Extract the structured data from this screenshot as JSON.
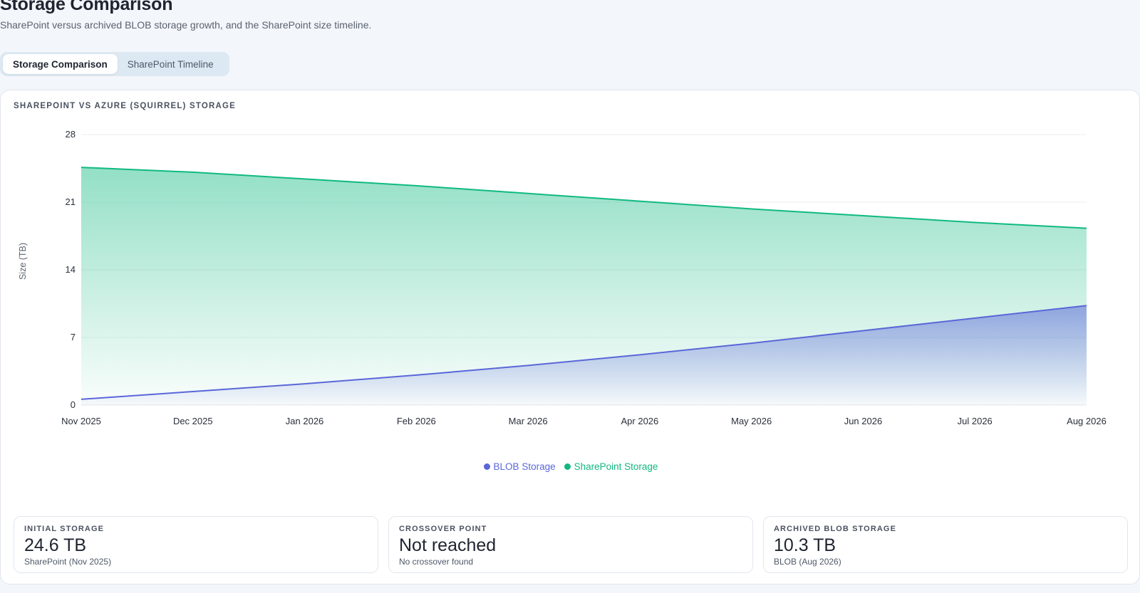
{
  "header": {
    "title": "Storage Comparison",
    "subtitle": "SharePoint versus archived BLOB storage growth, and the SharePoint size timeline."
  },
  "tabs": [
    {
      "label": "Storage Comparison",
      "active": true
    },
    {
      "label": "SharePoint Timeline",
      "active": false
    }
  ],
  "card": {
    "title": "SHAREPOINT VS AZURE (SQUIRREL) STORAGE"
  },
  "chart_data": {
    "type": "area",
    "categories": [
      "Nov 2025",
      "Dec 2025",
      "Jan 2026",
      "Feb 2026",
      "Mar 2026",
      "Apr 2026",
      "May 2026",
      "Jun 2026",
      "Jul 2026",
      "Aug 2026"
    ],
    "series": [
      {
        "name": "BLOB Storage",
        "color": "#5a67d8",
        "values": [
          0.6,
          1.4,
          2.2,
          3.1,
          4.1,
          5.2,
          6.4,
          7.7,
          9.0,
          10.3
        ]
      },
      {
        "name": "SharePoint Storage",
        "color": "#10b981",
        "values": [
          24.6,
          24.1,
          23.4,
          22.7,
          21.9,
          21.1,
          20.3,
          19.6,
          18.9,
          18.3
        ]
      }
    ],
    "ylabel": "Size (TB)",
    "yticks": [
      0,
      7,
      14,
      21,
      28
    ],
    "ylim": [
      0,
      28
    ],
    "grid": true,
    "legend": "bottom-center"
  },
  "legend": {
    "blob": "BLOB Storage",
    "sharepoint": "SharePoint Storage",
    "blob_color": "#5a67d8",
    "sharepoint_color": "#10b981"
  },
  "stats": [
    {
      "label": "INITIAL STORAGE",
      "value": "24.6 TB",
      "sub": "SharePoint (Nov 2025)"
    },
    {
      "label": "CROSSOVER POINT",
      "value": "Not reached",
      "sub": "No crossover found"
    },
    {
      "label": "ARCHIVED BLOB STORAGE",
      "value": "10.3 TB",
      "sub": "BLOB (Aug 2026)"
    }
  ]
}
